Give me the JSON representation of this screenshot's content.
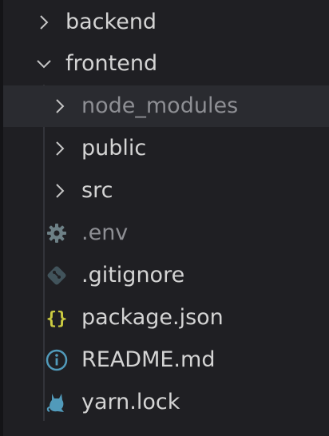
{
  "tree": {
    "items": [
      {
        "label": "backend",
        "kind": "folder",
        "expanded": false,
        "icon": "chevron-right-icon"
      },
      {
        "label": "frontend",
        "kind": "folder",
        "expanded": true,
        "icon": "chevron-down-icon"
      },
      {
        "label": "node_modules",
        "kind": "folder",
        "expanded": false,
        "icon": "chevron-right-icon",
        "dimmed": true
      },
      {
        "label": "public",
        "kind": "folder",
        "expanded": false,
        "icon": "chevron-right-icon"
      },
      {
        "label": "src",
        "kind": "folder",
        "expanded": false,
        "icon": "chevron-right-icon"
      },
      {
        "label": ".env",
        "kind": "file",
        "icon": "gear-icon",
        "dimmed": true
      },
      {
        "label": ".gitignore",
        "kind": "file",
        "icon": "git-icon"
      },
      {
        "label": "package.json",
        "kind": "file",
        "icon": "json-braces-icon"
      },
      {
        "label": "README.md",
        "kind": "file",
        "icon": "info-icon"
      },
      {
        "label": "yarn.lock",
        "kind": "file",
        "icon": "yarn-cat-icon"
      }
    ]
  },
  "colors": {
    "background": "#1f1f23",
    "hover_row": "#2a2b30",
    "text": "#d4d4d4",
    "dim_text": "#8e8f94",
    "json_icon": "#cbcb41",
    "info_icon": "#519aba",
    "gear_icon": "#6d8086",
    "git_icon": "#41535b",
    "yarn_icon": "#519aba"
  }
}
